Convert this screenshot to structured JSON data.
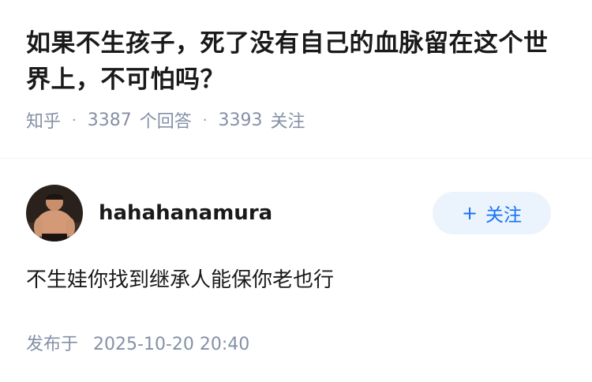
{
  "question": {
    "title": "如果不生孩子，死了没有自己的血脉留在这个世界上，不可怕吗？",
    "source": "知乎",
    "answer_count": "3387",
    "answer_label": "个回答",
    "follower_count": "3393",
    "follower_label": "关注"
  },
  "answer": {
    "author": {
      "name": "hahahanamura",
      "avatar_icon": "user-avatar"
    },
    "follow_button": {
      "icon": "plus",
      "label": "关注"
    },
    "content": "不生娃你找到继承人能保你老也行",
    "publish_label": "发布于",
    "publish_time": "2025-10-20 20:40"
  },
  "colors": {
    "meta_gray": "#8590a6",
    "brand_blue": "#1772f6",
    "follow_bg": "#ebf3fc",
    "text": "#1a1a1a"
  }
}
